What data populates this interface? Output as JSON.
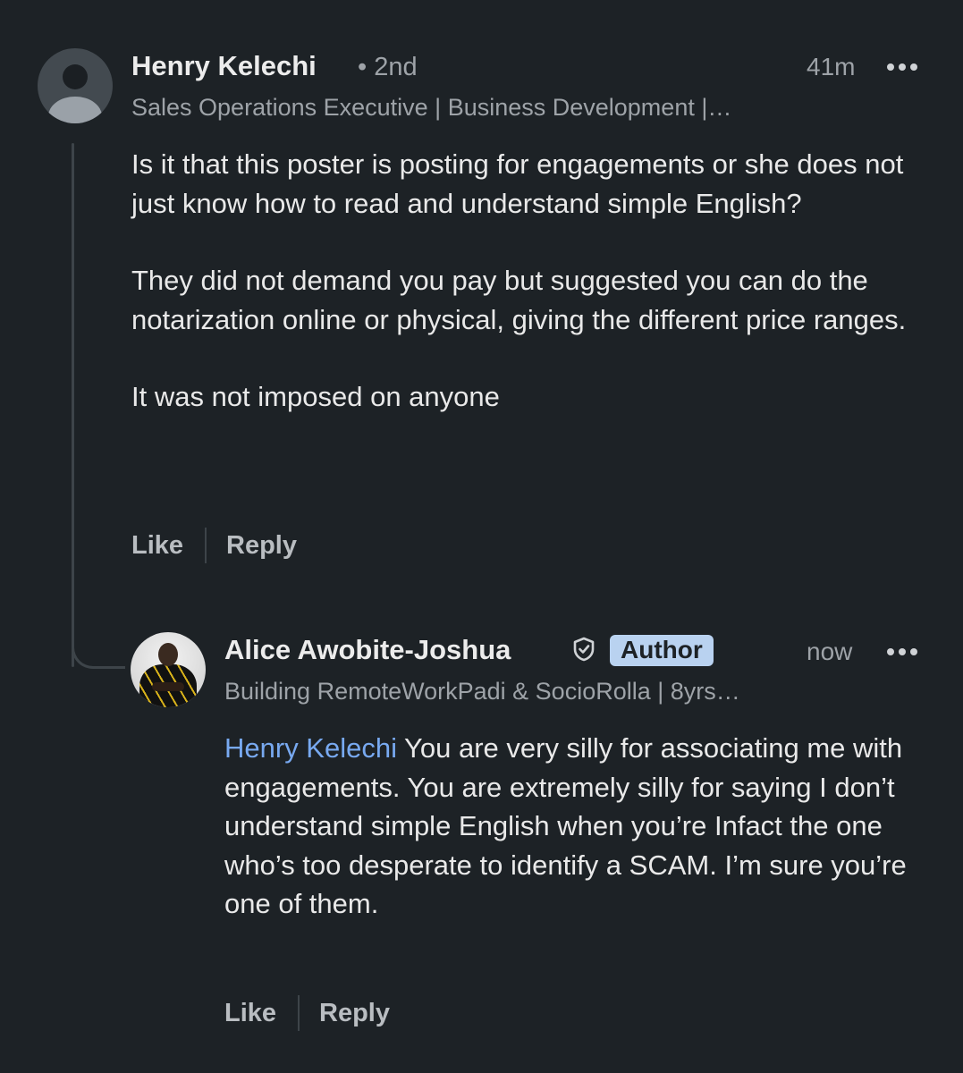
{
  "comment1": {
    "author_name": "Henry Kelechi",
    "degree": "• 2nd",
    "headline": "Sales Operations Executive | Business Development |…",
    "time": "41m",
    "paragraphs": [
      "Is it that this poster is posting for engagements or she does not just know how to read and understand simple English?",
      "They did not demand you pay but suggested you can do the notarization online or physical, giving the different price ranges.",
      "It was not imposed on anyone"
    ],
    "like_label": "Like",
    "reply_label": "Reply"
  },
  "comment2": {
    "author_name": "Alice Awobite-Joshua",
    "badge": "Author",
    "headline": "Building RemoteWorkPadi & SocioRolla | 8yrs…",
    "time": "now",
    "mention": "Henry Kelechi",
    "text": " You are very silly for associating me with engagements. You are extremely silly for saying I don’t understand simple English when you’re Infact the one who’s too desperate to identify a SCAM. I’m sure you’re one of them.",
    "like_label": "Like",
    "reply_label": "Reply"
  },
  "icons": {
    "more": "more-horizontal-icon",
    "verified": "verified-shield-icon"
  },
  "colors": {
    "background": "#1d2226",
    "mention": "#78a9f0",
    "author_badge": "#b9d2f0"
  }
}
